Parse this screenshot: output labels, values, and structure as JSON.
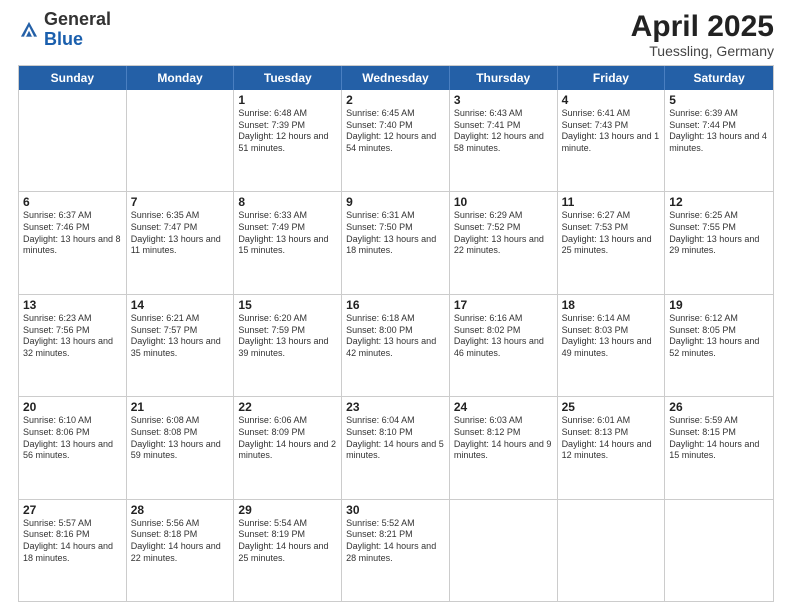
{
  "logo": {
    "general": "General",
    "blue": "Blue"
  },
  "header": {
    "month": "April 2025",
    "location": "Tuessling, Germany"
  },
  "weekdays": [
    "Sunday",
    "Monday",
    "Tuesday",
    "Wednesday",
    "Thursday",
    "Friday",
    "Saturday"
  ],
  "weeks": [
    [
      {
        "day": "",
        "info": ""
      },
      {
        "day": "",
        "info": ""
      },
      {
        "day": "1",
        "info": "Sunrise: 6:48 AM\nSunset: 7:39 PM\nDaylight: 12 hours and 51 minutes."
      },
      {
        "day": "2",
        "info": "Sunrise: 6:45 AM\nSunset: 7:40 PM\nDaylight: 12 hours and 54 minutes."
      },
      {
        "day": "3",
        "info": "Sunrise: 6:43 AM\nSunset: 7:41 PM\nDaylight: 12 hours and 58 minutes."
      },
      {
        "day": "4",
        "info": "Sunrise: 6:41 AM\nSunset: 7:43 PM\nDaylight: 13 hours and 1 minute."
      },
      {
        "day": "5",
        "info": "Sunrise: 6:39 AM\nSunset: 7:44 PM\nDaylight: 13 hours and 4 minutes."
      }
    ],
    [
      {
        "day": "6",
        "info": "Sunrise: 6:37 AM\nSunset: 7:46 PM\nDaylight: 13 hours and 8 minutes."
      },
      {
        "day": "7",
        "info": "Sunrise: 6:35 AM\nSunset: 7:47 PM\nDaylight: 13 hours and 11 minutes."
      },
      {
        "day": "8",
        "info": "Sunrise: 6:33 AM\nSunset: 7:49 PM\nDaylight: 13 hours and 15 minutes."
      },
      {
        "day": "9",
        "info": "Sunrise: 6:31 AM\nSunset: 7:50 PM\nDaylight: 13 hours and 18 minutes."
      },
      {
        "day": "10",
        "info": "Sunrise: 6:29 AM\nSunset: 7:52 PM\nDaylight: 13 hours and 22 minutes."
      },
      {
        "day": "11",
        "info": "Sunrise: 6:27 AM\nSunset: 7:53 PM\nDaylight: 13 hours and 25 minutes."
      },
      {
        "day": "12",
        "info": "Sunrise: 6:25 AM\nSunset: 7:55 PM\nDaylight: 13 hours and 29 minutes."
      }
    ],
    [
      {
        "day": "13",
        "info": "Sunrise: 6:23 AM\nSunset: 7:56 PM\nDaylight: 13 hours and 32 minutes."
      },
      {
        "day": "14",
        "info": "Sunrise: 6:21 AM\nSunset: 7:57 PM\nDaylight: 13 hours and 35 minutes."
      },
      {
        "day": "15",
        "info": "Sunrise: 6:20 AM\nSunset: 7:59 PM\nDaylight: 13 hours and 39 minutes."
      },
      {
        "day": "16",
        "info": "Sunrise: 6:18 AM\nSunset: 8:00 PM\nDaylight: 13 hours and 42 minutes."
      },
      {
        "day": "17",
        "info": "Sunrise: 6:16 AM\nSunset: 8:02 PM\nDaylight: 13 hours and 46 minutes."
      },
      {
        "day": "18",
        "info": "Sunrise: 6:14 AM\nSunset: 8:03 PM\nDaylight: 13 hours and 49 minutes."
      },
      {
        "day": "19",
        "info": "Sunrise: 6:12 AM\nSunset: 8:05 PM\nDaylight: 13 hours and 52 minutes."
      }
    ],
    [
      {
        "day": "20",
        "info": "Sunrise: 6:10 AM\nSunset: 8:06 PM\nDaylight: 13 hours and 56 minutes."
      },
      {
        "day": "21",
        "info": "Sunrise: 6:08 AM\nSunset: 8:08 PM\nDaylight: 13 hours and 59 minutes."
      },
      {
        "day": "22",
        "info": "Sunrise: 6:06 AM\nSunset: 8:09 PM\nDaylight: 14 hours and 2 minutes."
      },
      {
        "day": "23",
        "info": "Sunrise: 6:04 AM\nSunset: 8:10 PM\nDaylight: 14 hours and 5 minutes."
      },
      {
        "day": "24",
        "info": "Sunrise: 6:03 AM\nSunset: 8:12 PM\nDaylight: 14 hours and 9 minutes."
      },
      {
        "day": "25",
        "info": "Sunrise: 6:01 AM\nSunset: 8:13 PM\nDaylight: 14 hours and 12 minutes."
      },
      {
        "day": "26",
        "info": "Sunrise: 5:59 AM\nSunset: 8:15 PM\nDaylight: 14 hours and 15 minutes."
      }
    ],
    [
      {
        "day": "27",
        "info": "Sunrise: 5:57 AM\nSunset: 8:16 PM\nDaylight: 14 hours and 18 minutes."
      },
      {
        "day": "28",
        "info": "Sunrise: 5:56 AM\nSunset: 8:18 PM\nDaylight: 14 hours and 22 minutes."
      },
      {
        "day": "29",
        "info": "Sunrise: 5:54 AM\nSunset: 8:19 PM\nDaylight: 14 hours and 25 minutes."
      },
      {
        "day": "30",
        "info": "Sunrise: 5:52 AM\nSunset: 8:21 PM\nDaylight: 14 hours and 28 minutes."
      },
      {
        "day": "",
        "info": ""
      },
      {
        "day": "",
        "info": ""
      },
      {
        "day": "",
        "info": ""
      }
    ]
  ]
}
